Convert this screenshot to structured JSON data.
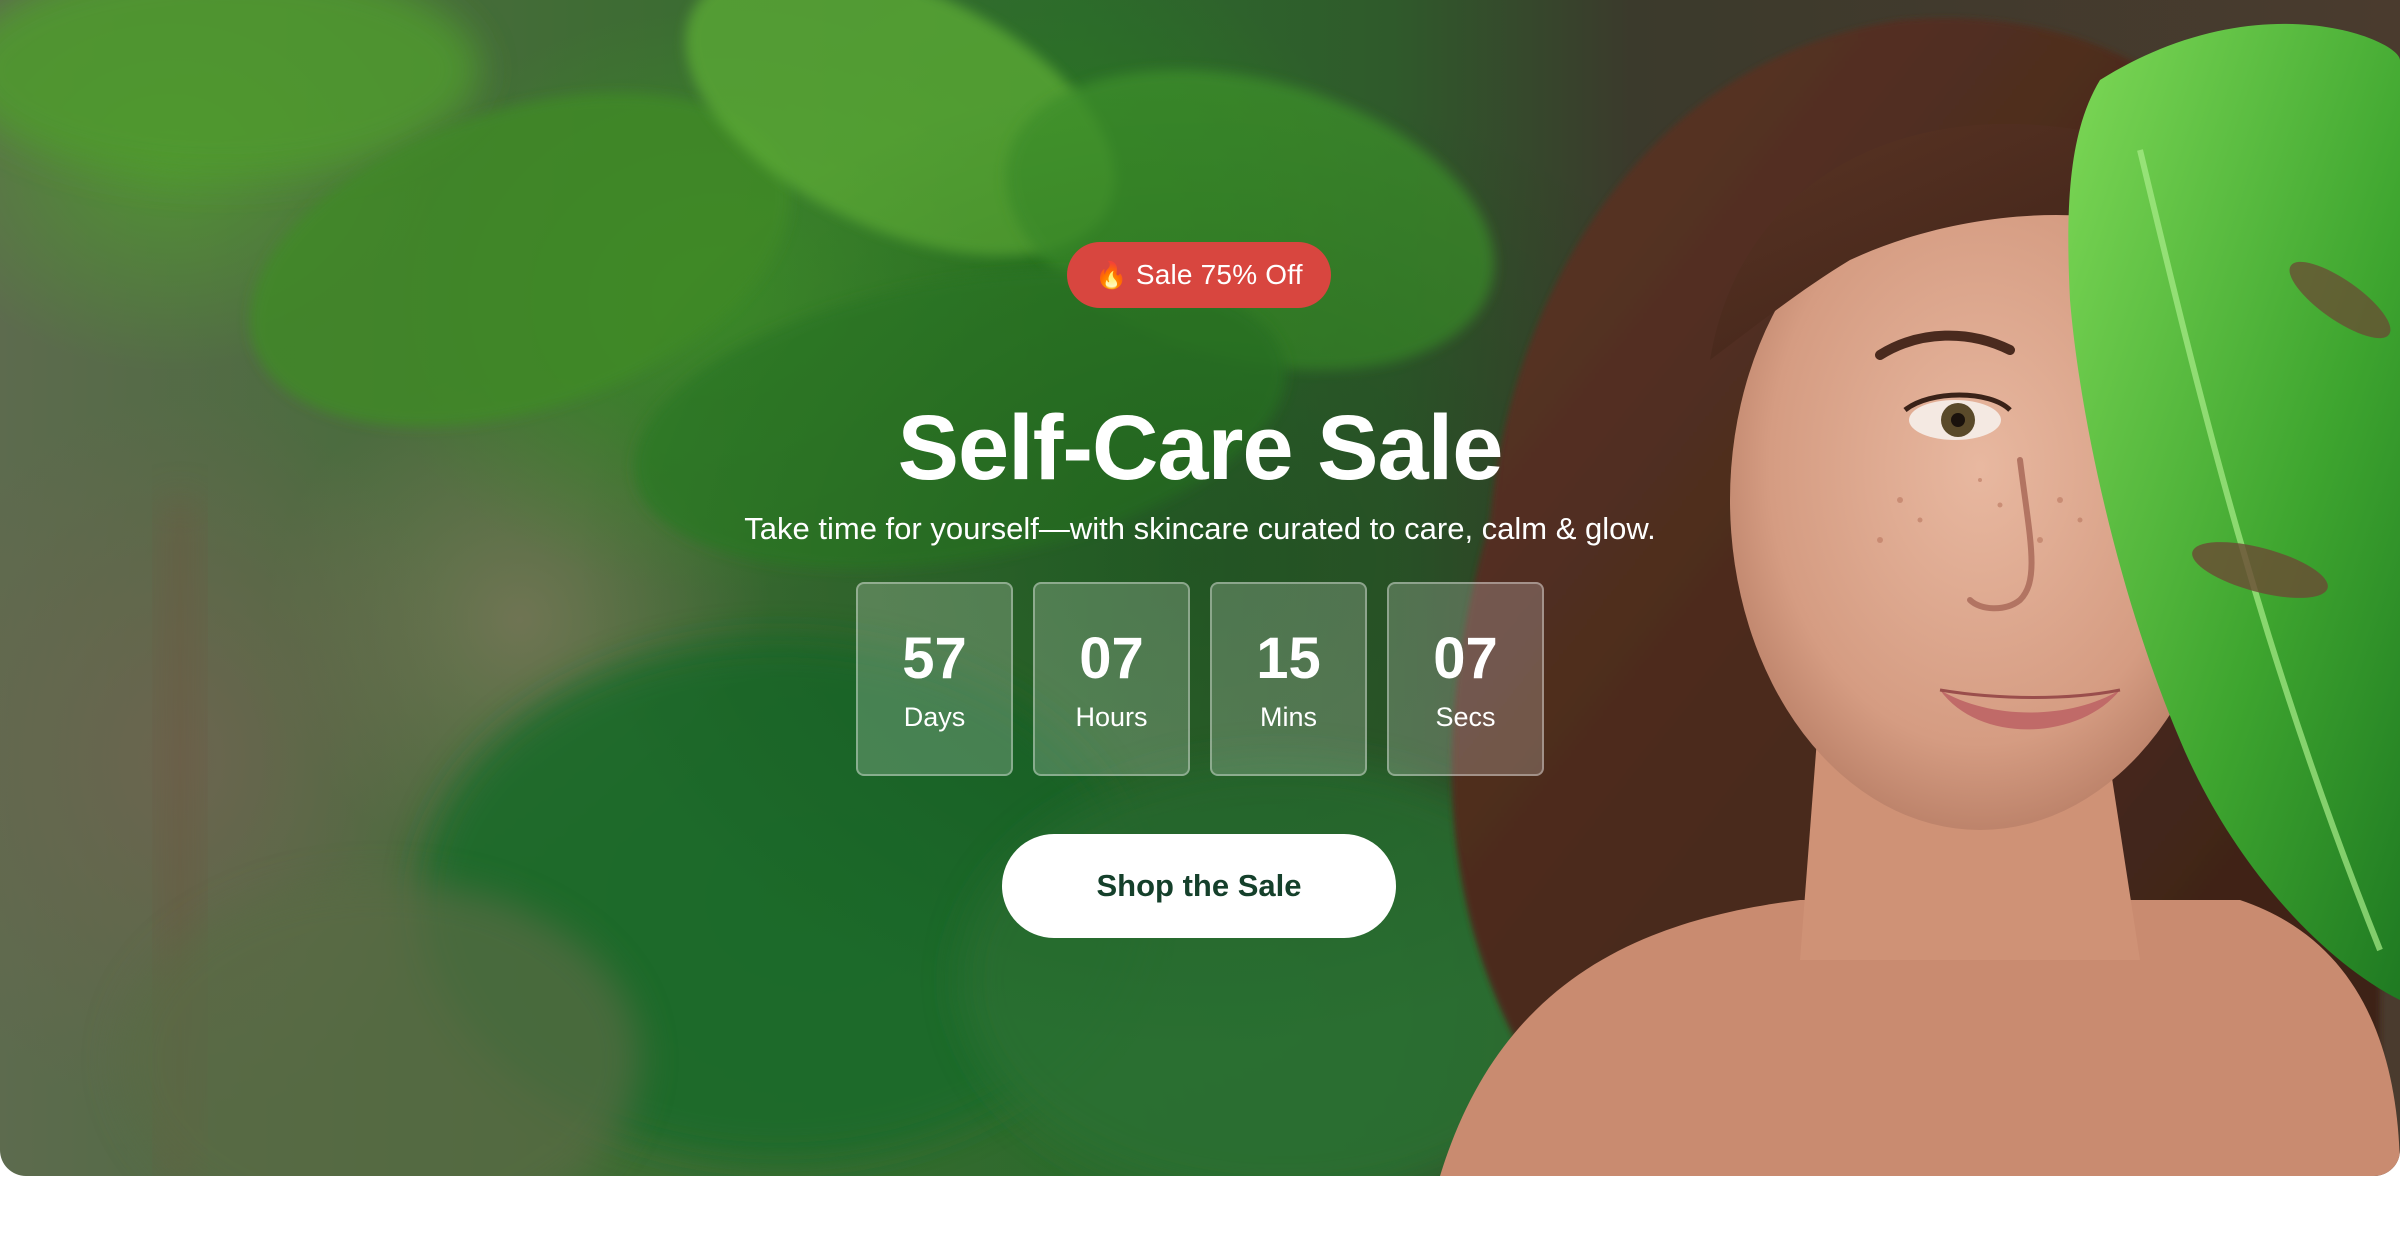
{
  "hero": {
    "badge": {
      "icon": "fire-icon",
      "icon_glyph": "🔥",
      "label": "Sale 75% Off",
      "color": "#d8463f"
    },
    "title": "Self-Care Sale",
    "subtitle": "Take time for yourself—with skincare curated to care, calm & glow.",
    "countdown": [
      {
        "value": "57",
        "label": "Days"
      },
      {
        "value": "07",
        "label": "Hours"
      },
      {
        "value": "15",
        "label": "Mins"
      },
      {
        "value": "07",
        "label": "Secs"
      }
    ],
    "cta": {
      "label": "Shop the Sale",
      "text_color": "#15402b"
    }
  },
  "colors": {
    "accent_green": "#2d6a2c",
    "badge_red": "#d8463f",
    "button_bg": "#ffffff"
  }
}
